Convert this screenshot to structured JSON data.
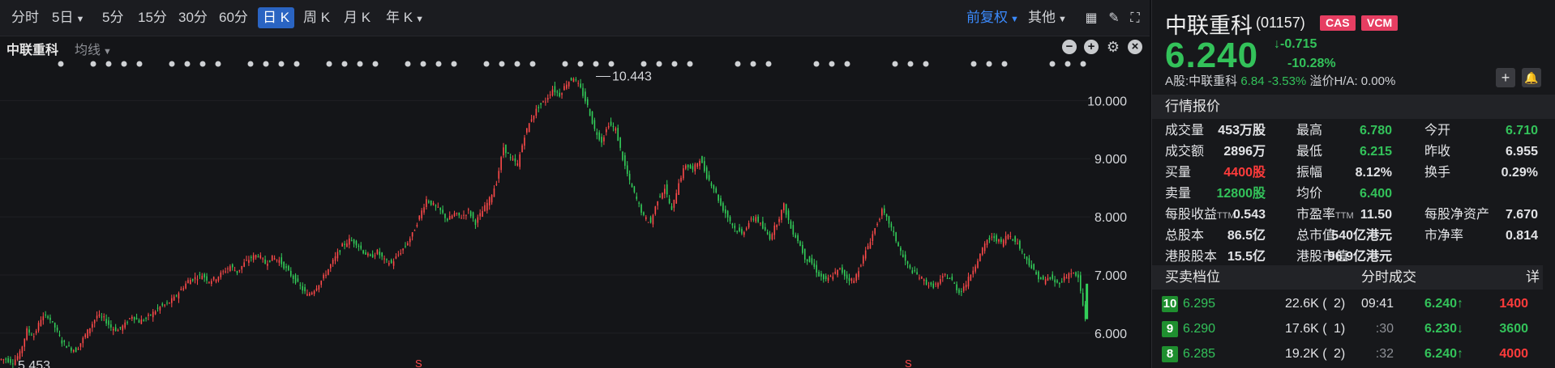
{
  "toolbar": {
    "periods": [
      "分时",
      "5日",
      "5分",
      "15分",
      "30分",
      "60分",
      "日 K",
      "周 K",
      "月 K",
      "年 K"
    ],
    "active_period": "日 K",
    "adjust": "前复权",
    "other": "其他"
  },
  "chart_header": {
    "title": "中联重科",
    "ma_label": "均线"
  },
  "chart_data": {
    "type": "candlestick",
    "ylim": [
      5.4,
      10.7
    ],
    "y_ticks": [
      "10.000",
      "9.000",
      "8.000",
      "7.000",
      "6.000"
    ],
    "y_tick_values": [
      10,
      9,
      8,
      7,
      6
    ],
    "annotations": {
      "high_label": "10.443",
      "low_label": "5.453"
    },
    "markers": [
      "S",
      "S"
    ],
    "series_close": [
      5.55,
      5.5,
      5.65,
      6.05,
      5.95,
      6.25,
      6.3,
      6.1,
      5.85,
      5.75,
      5.7,
      5.9,
      6.1,
      6.3,
      6.25,
      6.1,
      6.05,
      6.15,
      6.3,
      6.2,
      6.25,
      6.35,
      6.45,
      6.5,
      6.6,
      6.75,
      6.9,
      6.95,
      7.0,
      6.9,
      6.95,
      7.05,
      7.15,
      7.05,
      7.2,
      7.3,
      7.35,
      7.2,
      7.3,
      7.25,
      7.1,
      6.95,
      6.8,
      6.65,
      6.75,
      6.9,
      7.1,
      7.3,
      7.5,
      7.6,
      7.55,
      7.4,
      7.3,
      7.4,
      7.25,
      7.2,
      7.35,
      7.5,
      7.7,
      8.0,
      8.3,
      8.2,
      8.1,
      7.95,
      8.05,
      8.0,
      8.1,
      7.9,
      8.1,
      8.3,
      8.6,
      9.2,
      9.0,
      8.9,
      9.4,
      9.7,
      9.9,
      10.0,
      10.2,
      10.1,
      10.3,
      10.4,
      10.2,
      9.9,
      9.5,
      9.3,
      9.6,
      9.5,
      9.0,
      8.6,
      8.3,
      8.0,
      7.9,
      8.3,
      8.5,
      8.1,
      8.6,
      8.9,
      8.8,
      9.0,
      8.7,
      8.5,
      8.2,
      8.0,
      7.8,
      7.7,
      7.9,
      8.0,
      7.8,
      7.65,
      7.9,
      8.2,
      7.8,
      7.6,
      7.3,
      7.2,
      7.0,
      6.9,
      7.0,
      7.1,
      6.95,
      6.9,
      7.2,
      7.5,
      7.8,
      8.1,
      7.9,
      7.6,
      7.3,
      7.1,
      7.0,
      6.9,
      6.8,
      6.85,
      7.0,
      6.9,
      6.7,
      6.85,
      7.1,
      7.35,
      7.6,
      7.65,
      7.55,
      7.7,
      7.6,
      7.4,
      7.2,
      7.0,
      6.9,
      6.95,
      6.85,
      6.95,
      7.05,
      6.95,
      6.24
    ]
  },
  "quote": {
    "name": "中联重科",
    "code": "(01157)",
    "badges": [
      "CAS",
      "VCM"
    ],
    "price": "6.240",
    "change": "↓-0.715",
    "change_pct": "-10.28%",
    "a_share_label": "A股:中联重科",
    "a_share_price": "6.84",
    "a_share_pct": "-3.53%",
    "premium": "溢价H/A: 0.00%",
    "section_title": "行情报价",
    "stats": [
      {
        "label": "成交量",
        "value": "453万股",
        "color": "#e2e3e6"
      },
      {
        "label": "最高",
        "value": "6.780",
        "color": "#33c25a"
      },
      {
        "label": "今开",
        "value": "6.710",
        "color": "#33c25a"
      },
      {
        "label": "成交额",
        "value": "2896万",
        "color": "#e2e3e6"
      },
      {
        "label": "最低",
        "value": "6.215",
        "color": "#33c25a"
      },
      {
        "label": "昨收",
        "value": "6.955",
        "color": "#e2e3e6"
      },
      {
        "label": "买量",
        "value": "4400股",
        "color": "#ff3b3b"
      },
      {
        "label": "振幅",
        "value": "8.12%",
        "color": "#e2e3e6"
      },
      {
        "label": "换手",
        "value": "0.29%",
        "color": "#e2e3e6"
      },
      {
        "label": "卖量",
        "value": "12800股",
        "color": "#33c25a"
      },
      {
        "label": "均价",
        "value": "6.400",
        "color": "#33c25a"
      },
      {
        "label": "",
        "value": "",
        "color": "#e2e3e6"
      },
      {
        "label": "每股收益",
        "sup": "TTM",
        "value": "0.543",
        "color": "#e2e3e6"
      },
      {
        "label": "市盈率",
        "sup": "TTM",
        "value": "11.50",
        "color": "#e2e3e6"
      },
      {
        "label": "每股净资产",
        "value": "7.670",
        "color": "#e2e3e6"
      },
      {
        "label": "总股本",
        "value": "86.5亿",
        "color": "#e2e3e6"
      },
      {
        "label": "总市值",
        "value": "540亿港元",
        "color": "#e2e3e6"
      },
      {
        "label": "市净率",
        "value": "0.814",
        "color": "#e2e3e6"
      },
      {
        "label": "港股股本",
        "value": "15.5亿",
        "color": "#e2e3e6"
      },
      {
        "label": "港股市值",
        "value": "96.9亿港元",
        "color": "#e2e3e6"
      },
      {
        "label": "",
        "value": "",
        "color": "#e2e3e6"
      }
    ],
    "order_book_title": "买卖档位",
    "trades_title": "分时成交",
    "trades_detail": "详",
    "order_book": [
      {
        "level": "10",
        "price": "6.295",
        "volume": "22.6K",
        "count": "2)"
      },
      {
        "level": "9",
        "price": "6.290",
        "volume": "17.6K",
        "count": "1)"
      },
      {
        "level": "8",
        "price": "6.285",
        "volume": "19.2K",
        "count": "2)"
      }
    ],
    "trades": [
      {
        "time": "09:41",
        "price": "6.240↑",
        "volume": "1400",
        "color": "#33c25a",
        "vcolor": "#ff3b3b"
      },
      {
        "time": ":30",
        "price": "6.230↓",
        "volume": "3600",
        "color": "#33c25a",
        "vcolor": "#33c25a"
      },
      {
        "time": ":32",
        "price": "6.240↑",
        "volume": "4000",
        "color": "#33c25a",
        "vcolor": "#ff3b3b"
      }
    ]
  }
}
